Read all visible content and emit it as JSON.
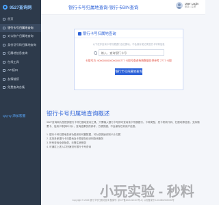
{
  "header": {
    "logo_text": "9527查询网",
    "page_title": "银行卡号归属地查询-银行卡BIN查询",
    "user_name": "User Login",
    "user_sub": "登录 | 注册"
  },
  "sidebar": {
    "items": [
      {
        "label": "首页",
        "icon": "home-icon"
      },
      {
        "label": "银行卡号归属地查询",
        "icon": "card-icon"
      },
      {
        "label": "对公账户归属地查询",
        "icon": "account-icon"
      },
      {
        "label": "身份证号码归属地查询",
        "icon": "idcard-icon"
      },
      {
        "label": "归属地信息查询",
        "icon": "location-icon"
      },
      {
        "label": "在线工具",
        "icon": "tool-icon"
      },
      {
        "label": "API接口",
        "icon": "api-icon"
      },
      {
        "label": "友情链接",
        "icon": "link-icon"
      },
      {
        "label": "免费查询合集",
        "icon": "collection-icon"
      }
    ],
    "qq": "QQ-Q 添加客服"
  },
  "search": {
    "title": "银行卡号归属地查询",
    "note": "以下仅作查询卡号所属银行及归属地，不会保存或记录您的卡号等信息",
    "placeholder": "输入、查询银行卡号",
    "tip": "卡取号方: 9000000000000000777 卡取号查询系统数据仅供参考 7777 卡取",
    "button": "银行卡号归属地查询"
  },
  "article": {
    "title": "银行卡号归属地查询概述",
    "paragraph": "9527查询网为您提供银行卡号归属地查询工具，只需输入银行卡号即可查询该卡所属银行、卡种类型、发卡机构代码、归属地等信息，支持储蓄卡、信用卡等多种卡片，查询结果仅供参考，方便快捷，不会保存任何用户信息。",
    "list": [
      "1. 银行卡号归属地查询功能采用可靠数据，可为您快速识别卡片归属",
      "2. 支持多家银行卡归属地及卡类型在线识别查询服务",
      "3. 所有查询全部免费，无需注册登录",
      "4. 可通过上述入口快速进行银行卡号查询"
    ]
  },
  "footer": {
    "text": "Copyright © 2023 银行卡号归属地查询 备案号: 京ICP备2021010157号-2 | 公安备案号 11010802000000号"
  },
  "watermark": {
    "text": "小玩实验 - 秒料"
  }
}
